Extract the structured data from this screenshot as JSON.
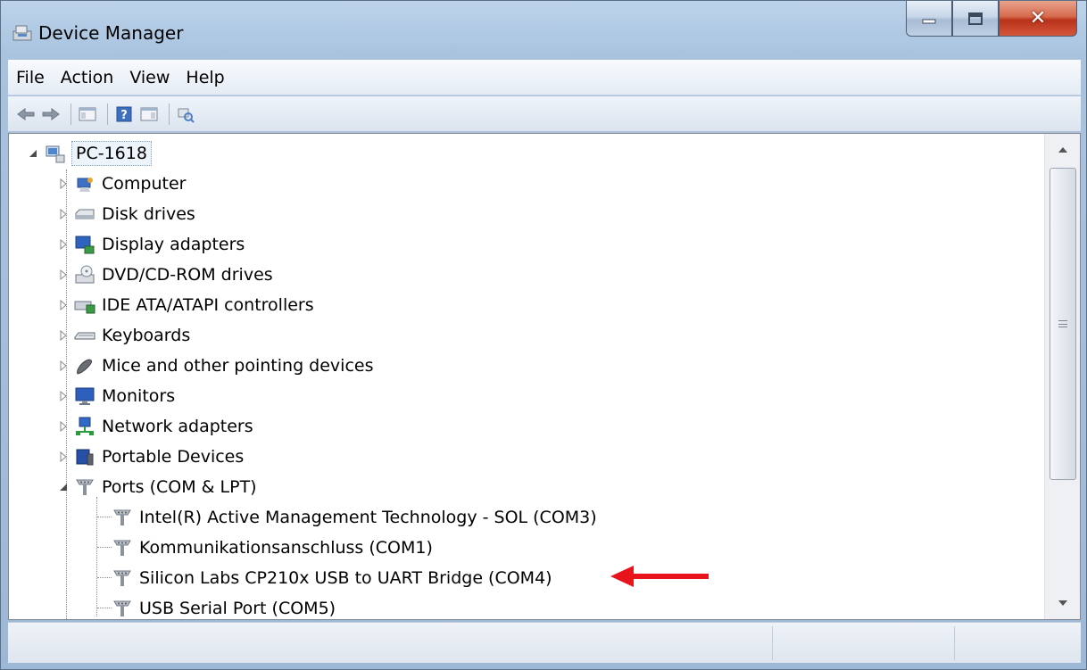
{
  "window": {
    "title": "Device Manager"
  },
  "menu": [
    "File",
    "Action",
    "View",
    "Help"
  ],
  "tree": {
    "root": {
      "label": "PC-1618",
      "icon": "computer-tree-icon"
    },
    "categories": [
      {
        "label": "Computer",
        "icon": "computer-icon"
      },
      {
        "label": "Disk drives",
        "icon": "disk-drive-icon"
      },
      {
        "label": "Display adapters",
        "icon": "display-adapter-icon"
      },
      {
        "label": "DVD/CD-ROM drives",
        "icon": "dvd-drive-icon"
      },
      {
        "label": "IDE ATA/ATAPI controllers",
        "icon": "ide-controller-icon"
      },
      {
        "label": "Keyboards",
        "icon": "keyboard-icon"
      },
      {
        "label": "Mice and other pointing devices",
        "icon": "mouse-icon"
      },
      {
        "label": "Monitors",
        "icon": "monitor-icon"
      },
      {
        "label": "Network adapters",
        "icon": "network-adapter-icon"
      },
      {
        "label": "Portable Devices",
        "icon": "portable-device-icon"
      },
      {
        "label": "Ports (COM & LPT)",
        "icon": "port-icon",
        "expanded": true
      }
    ],
    "ports": [
      {
        "label": "Intel(R) Active Management Technology - SOL (COM3)",
        "icon": "port-icon"
      },
      {
        "label": "Kommunikationsanschluss (COM1)",
        "icon": "port-icon"
      },
      {
        "label": "Silicon Labs CP210x USB to UART Bridge (COM4)",
        "icon": "port-icon"
      },
      {
        "label": "USB Serial Port (COM5)",
        "icon": "port-icon"
      }
    ]
  },
  "colors": {
    "annotation_arrow": "#e8141c",
    "selection_border": "#7da2ce",
    "title_bar": "#a9c3df",
    "close_button": "#c8432a"
  }
}
